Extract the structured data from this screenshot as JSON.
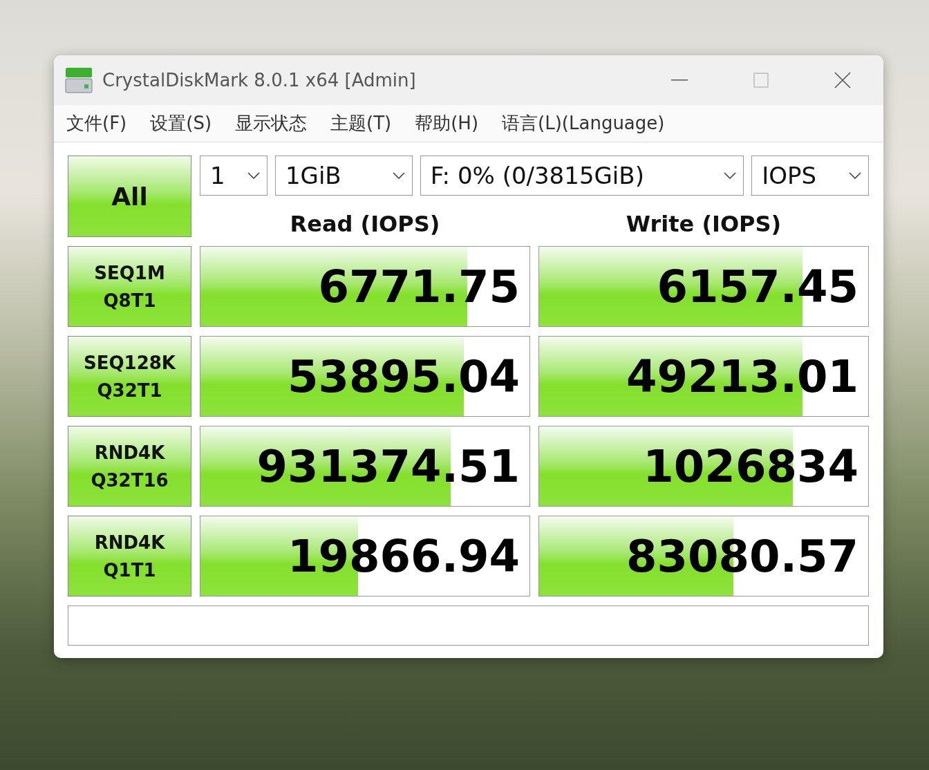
{
  "window": {
    "title": "CrystalDiskMark 8.0.1 x64 [Admin]"
  },
  "menu": [
    "文件(F)",
    "设置(S)",
    "显示状态",
    "主题(T)",
    "帮助(H)",
    "语言(L)(Language)"
  ],
  "all_button": "All",
  "selectors": [
    {
      "value": "1"
    },
    {
      "value": "1GiB"
    },
    {
      "value": "F: 0% (0/3815GiB)"
    },
    {
      "value": "IOPS"
    }
  ],
  "columns": [
    "Read (IOPS)",
    "Write (IOPS)"
  ],
  "tests": [
    {
      "label": [
        "SEQ1M",
        "Q8T1"
      ],
      "read": {
        "value": "6771.75",
        "level": 0.81
      },
      "write": {
        "value": "6157.45",
        "level": 0.8
      }
    },
    {
      "label": [
        "SEQ128K",
        "Q32T1"
      ],
      "read": {
        "value": "53895.04",
        "level": 0.8
      },
      "write": {
        "value": "49213.01",
        "level": 0.8
      }
    },
    {
      "label": [
        "RND4K",
        "Q32T16"
      ],
      "read": {
        "value": "931374.51",
        "level": 0.76
      },
      "write": {
        "value": "1026834",
        "level": 0.77
      }
    },
    {
      "label": [
        "RND4K",
        "Q1T1"
      ],
      "read": {
        "value": "19866.94",
        "level": 0.48
      },
      "write": {
        "value": "83080.57",
        "level": 0.59
      }
    }
  ]
}
